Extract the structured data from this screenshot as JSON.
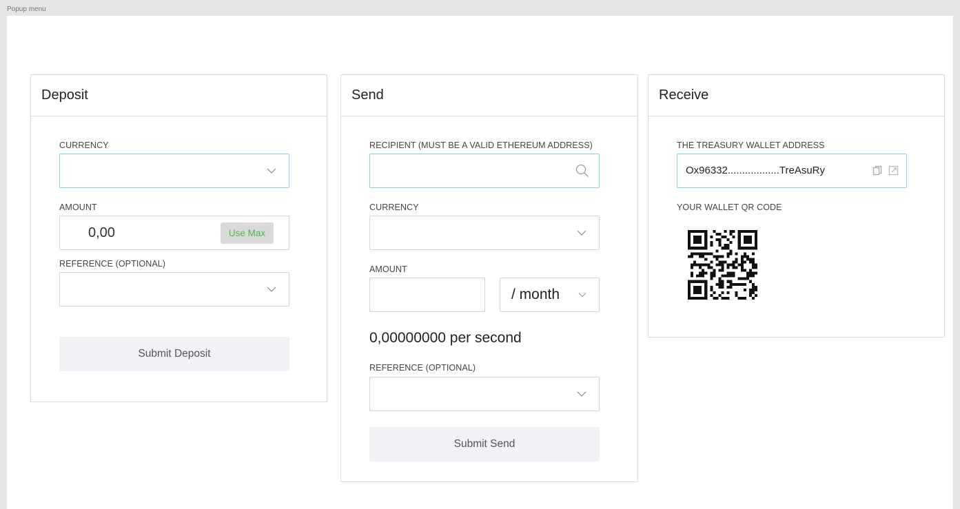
{
  "frame_label": "Popup menu",
  "deposit": {
    "title": "Deposit",
    "currency_label": "CURRENCY",
    "amount_label": "AMOUNT",
    "amount_value": "0,00",
    "use_max_label": "Use Max",
    "reference_label": "REFERENCE (OPTIONAL)",
    "submit_label": "Submit Deposit"
  },
  "send": {
    "title": "Send",
    "recipient_label": "RECIPIENT (MUST BE A VALID ETHEREUM ADDRESS)",
    "currency_label": "CURRENCY",
    "amount_label": "AMOUNT",
    "period_value": "/ month",
    "rate_text": "0,00000000 per second",
    "reference_label": "REFERENCE (OPTIONAL)",
    "submit_label": "Submit Send"
  },
  "receive": {
    "title": "Receive",
    "address_label": "THE TREASURY WALLET ADDRESS",
    "address_value": "Ox96332..................TreAsuRy",
    "qr_label": "YOUR WALLET QR CODE"
  },
  "colors": {
    "focus_border": "#7fd3dc",
    "use_max_text": "#4cb849",
    "button_bg": "#f1f2f5"
  },
  "icons": [
    "chevron-down-icon",
    "search-icon",
    "copy-icon",
    "external-link-icon",
    "qr-code"
  ]
}
